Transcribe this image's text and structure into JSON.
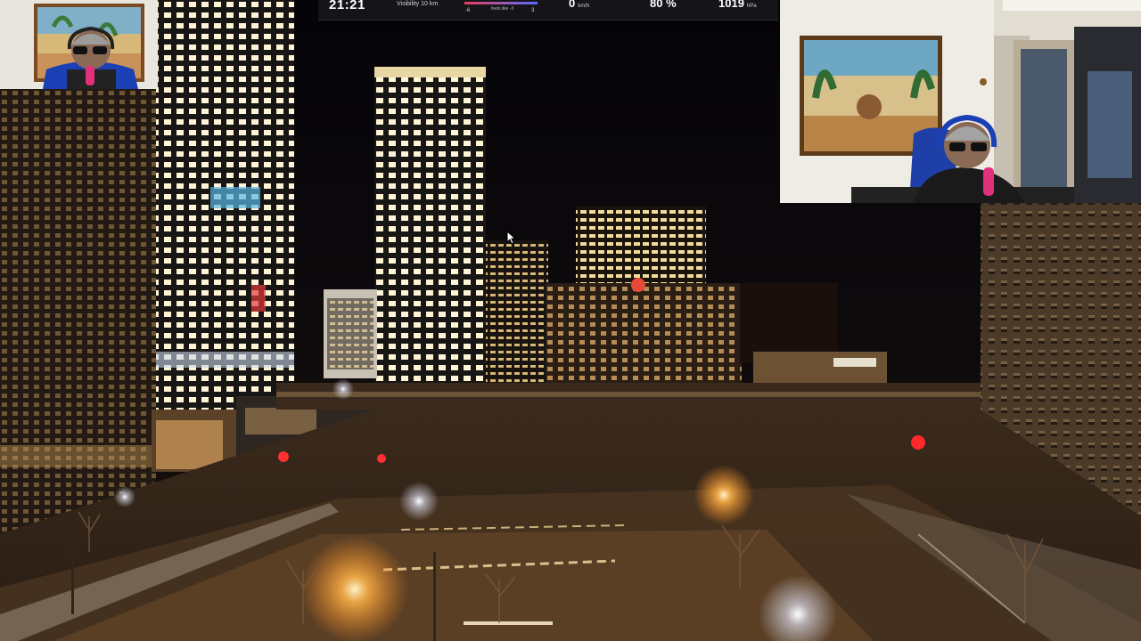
{
  "weather_hud": {
    "time": "21:21",
    "visibility": "Visibility 10 km",
    "feels_like": "feels like -3",
    "temp_min": "-6",
    "temp_max": "3",
    "wind_speed": "0",
    "wind_unit": "km/h",
    "humidity": "80 %",
    "pressure": "1019",
    "pressure_unit": "hPa"
  },
  "colors": {
    "hud_background": "#141419",
    "hud_bar_start": "#e84060",
    "hud_bar_end": "#5a6bff",
    "sky": "#07060a",
    "street_light": "#ffb347"
  },
  "camera_overlays": [
    "webcam-small-top-left",
    "webcam-large-top-right"
  ]
}
